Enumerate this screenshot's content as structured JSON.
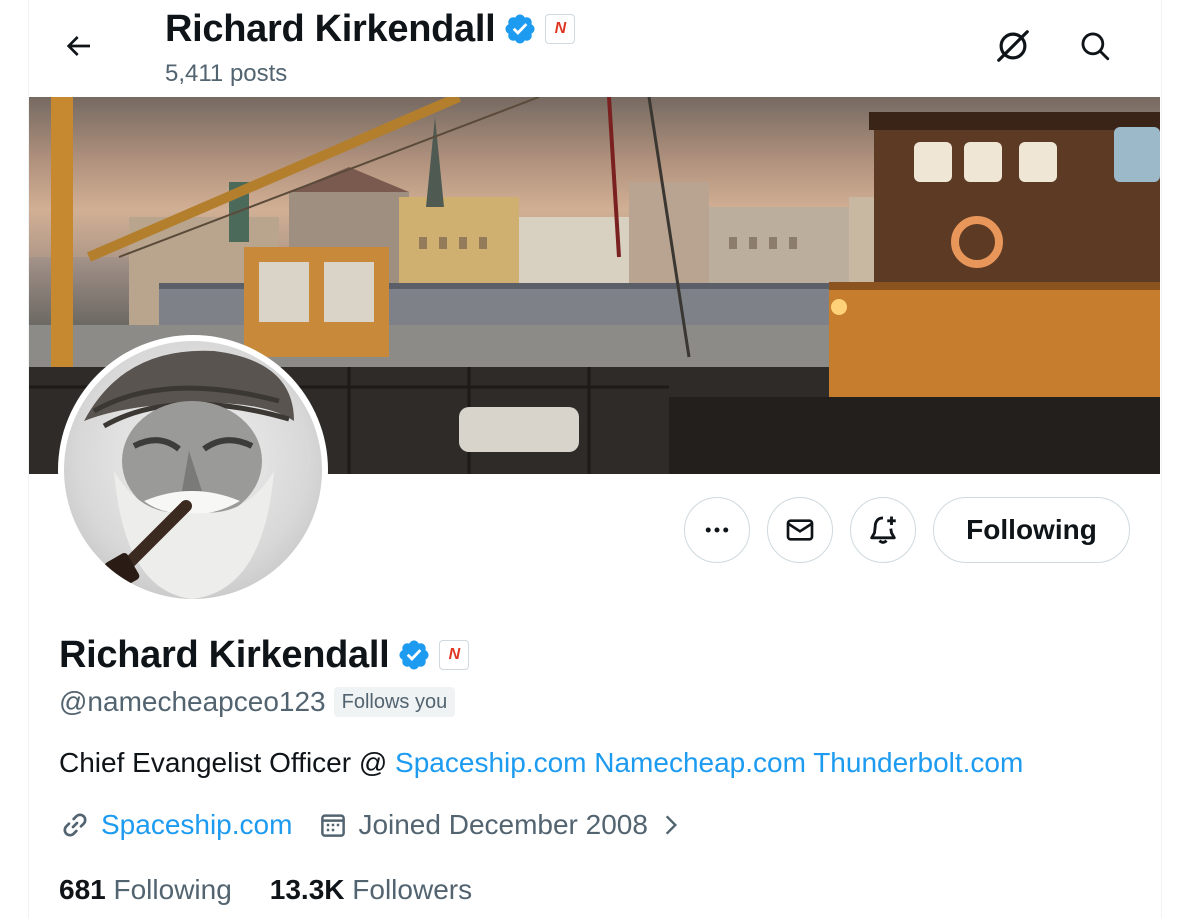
{
  "header": {
    "name": "Richard Kirkendall",
    "posts": "5,411 posts",
    "affiliate_badge": "N"
  },
  "profile": {
    "name": "Richard Kirkendall",
    "handle": "@namecheapceo123",
    "follows_you": "Follows you",
    "bio_prefix": "Chief Evangelist Officer @ ",
    "bio_links": [
      "Spaceship.com",
      "Namecheap.com",
      "Thunderbolt.com"
    ],
    "website": "Spaceship.com",
    "joined": "Joined December 2008",
    "following_count": "681",
    "following_label": "Following",
    "followers_count": "13.3K",
    "followers_label": "Followers"
  },
  "actions": {
    "more": "more-icon",
    "message": "mail-icon",
    "notify": "bell-plus-icon",
    "following_button": "Following"
  },
  "icons": {
    "back": "back-arrow-icon",
    "grok": "grok-icon",
    "search": "search-icon",
    "verified": "verified-badge-icon",
    "link": "link-icon",
    "calendar": "calendar-icon"
  },
  "colors": {
    "accent": "#1d9bf0",
    "text": "#0f1419",
    "secondary": "#536471",
    "border": "#cfd9de"
  }
}
